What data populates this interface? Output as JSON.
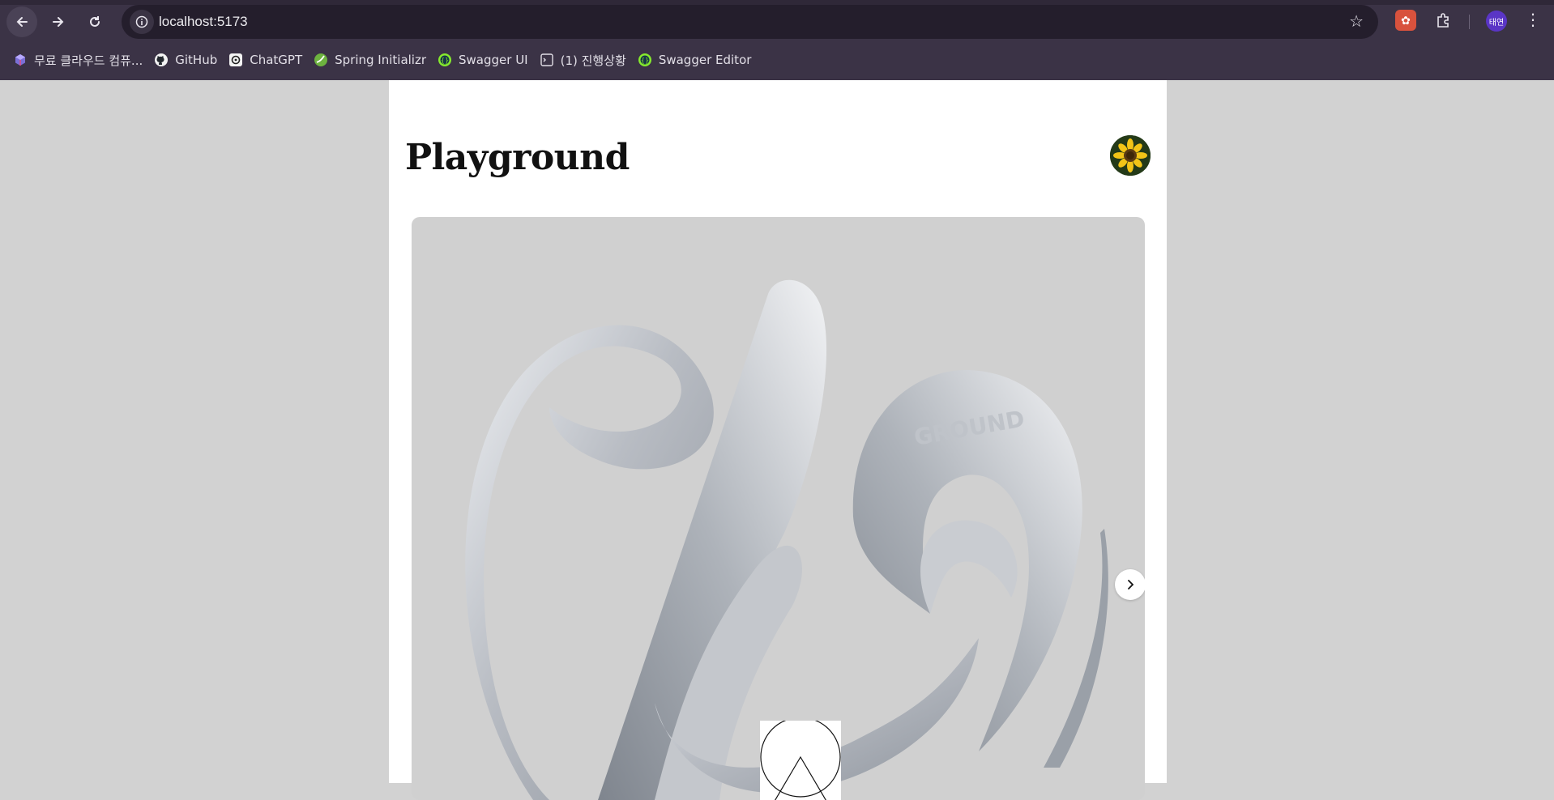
{
  "browser": {
    "url": "localhost:5173",
    "profile_initials": "태연",
    "bookmarks": [
      {
        "label": "무료 클라우드 컴퓨...",
        "icon": "cube-icon"
      },
      {
        "label": "GitHub",
        "icon": "github-icon"
      },
      {
        "label": "ChatGPT",
        "icon": "chatgpt-icon"
      },
      {
        "label": "Spring Initializr",
        "icon": "spring-icon"
      },
      {
        "label": "Swagger UI",
        "icon": "swagger-icon"
      },
      {
        "label": "(1) 진행상황",
        "icon": "terminal-icon"
      },
      {
        "label": "Swagger Editor",
        "icon": "swagger-icon"
      }
    ]
  },
  "page": {
    "title": "Playground",
    "carousel": {
      "slide_text": "GROUND",
      "next_icon": "chevron-right-icon"
    }
  },
  "colors": {
    "chrome": "#3b3346",
    "omnibox": "#241e2c",
    "page_bg": "#d2d2d2",
    "card_bg": "#d0d0d0"
  }
}
